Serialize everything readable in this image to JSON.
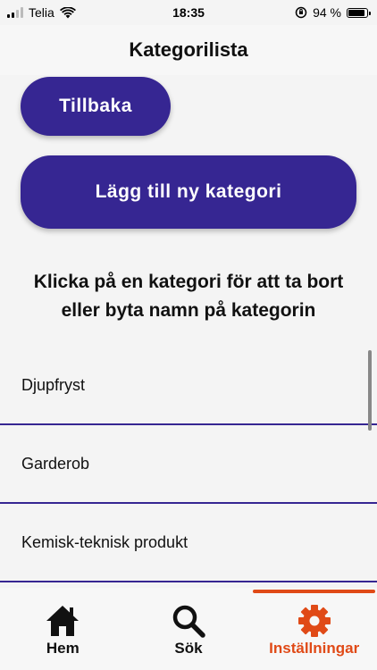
{
  "status_bar": {
    "carrier": "Telia",
    "time": "18:35",
    "battery_percent": "94 %",
    "battery_level": 0.94
  },
  "header": {
    "title": "Kategorilista"
  },
  "buttons": {
    "back_label": "Tillbaka",
    "add_label": "Lägg till ny kategori"
  },
  "instruction": "Klicka på en kategori för att ta bort eller byta namn på kategorin",
  "categories": [
    "Djupfryst",
    "Garderob",
    "Kemisk-teknisk produkt"
  ],
  "tabs": [
    {
      "label": "Hem",
      "icon": "home-icon",
      "active": false
    },
    {
      "label": "Sök",
      "icon": "search-icon",
      "active": false
    },
    {
      "label": "Inställningar",
      "icon": "gear-icon",
      "active": true
    }
  ],
  "colors": {
    "primary": "#362692",
    "accent": "#e04a17",
    "background": "#f4f4f4"
  }
}
